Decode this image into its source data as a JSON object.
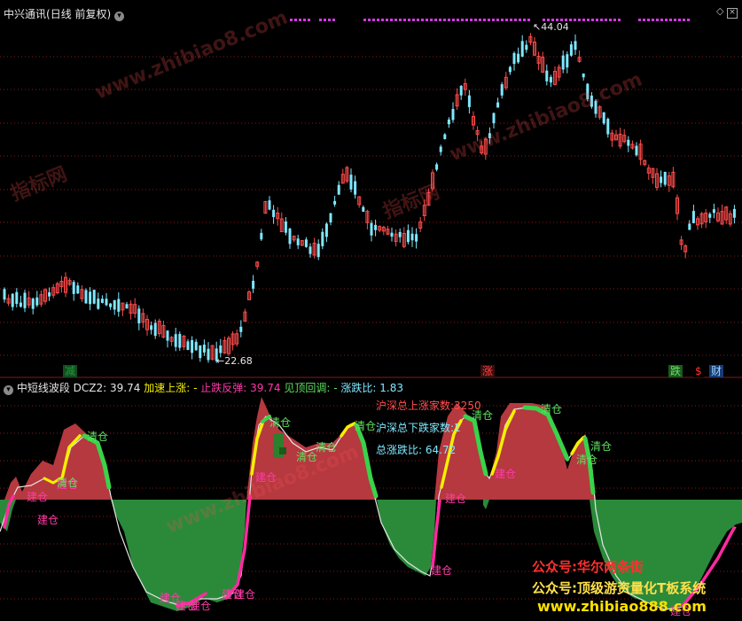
{
  "top_panel": {
    "title": "中兴通讯",
    "subtitle": "(日线 前复权)",
    "high_label": "44.04",
    "low_label": "22.68",
    "markers": [
      {
        "text": "减",
        "color": "#1e9b3a",
        "bg": "#144d1f"
      },
      {
        "text": "涨",
        "color": "#ff4040",
        "bg": "#3d0e0e"
      },
      {
        "text": "跌",
        "color": "#6ddb6d",
        "bg": "#1a5a1a"
      },
      {
        "text": "$",
        "color": "#ff3030",
        "bg": "#000000"
      },
      {
        "text": "财",
        "color": "#9fd2ff",
        "bg": "#173a73"
      }
    ]
  },
  "bottom_panel": {
    "name": "中短线波段",
    "dcz2_label": "DCZ2:",
    "dcz2_value": "39.74",
    "accel_label": "加速上涨:",
    "accel_value": "-",
    "rebound_label": "止跌反弹:",
    "rebound_value": "39.74",
    "pullback_label": "见顶回调:",
    "pullback_value": "-",
    "ratio_label": "涨跌比:",
    "ratio_value": "1.83",
    "info_up": "沪深总上涨家数:3250",
    "info_down": "沪深总下跌家数:1",
    "info_total": "总涨跌比: 64.72",
    "buy_label": "建仓",
    "sell_label": "清仓",
    "buy_signals": [
      "建仓",
      "建仓",
      "建仓",
      "建仓",
      "建仓",
      "建仓",
      "建仓",
      "建仓",
      "建仓",
      "建仓",
      "建仓"
    ],
    "sell_signals": [
      "清仓",
      "清仓",
      "清仓",
      "清仓",
      "清仓",
      "清仓",
      "清仓",
      "清仓",
      "清仓",
      "清仓"
    ]
  },
  "watermarks": {
    "site": "www.zhibiao8.com",
    "brand": "指标网",
    "promo1": "公众号:华尔两条街",
    "promo2": "公众号:顶级游资量化T板系统",
    "promo3": "www.zhibiao888.com"
  },
  "colors": {
    "up": "#ff4b4b",
    "down": "#7fe8ff",
    "grid": "#8a1818",
    "red_area": "#b5393f",
    "green_area": "#2a8a3a",
    "yellow": "#f4f000",
    "bright_green": "#39d34a",
    "magenta": "#ff2aa0",
    "white_line": "#e6e6e6",
    "dot_magenta": "#d838e6"
  }
}
